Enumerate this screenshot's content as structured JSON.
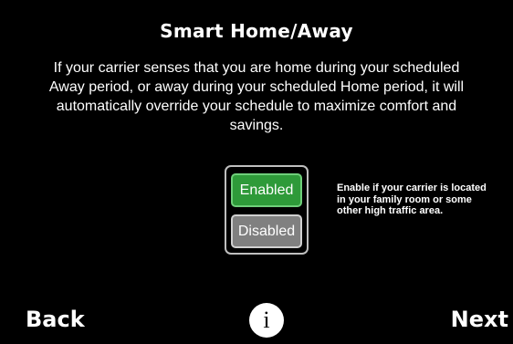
{
  "screen": {
    "title": "Smart Home/Away",
    "description": "If your carrier senses that you are home during your scheduled Away period, or away during your scheduled Home period, it will automatically override your schedule to maximize comfort and savings."
  },
  "toggle": {
    "enabled_label": "Enabled",
    "disabled_label": "Disabled",
    "selected": "Enabled"
  },
  "hint": "Enable if your carrier is located in your family room or some other high traffic area.",
  "footer": {
    "back_label": "Back",
    "info_label": "i",
    "next_label": "Next"
  },
  "colors": {
    "background": "#000000",
    "enabled_green": "#2e9a39",
    "disabled_gray": "#808080"
  },
  "icons": {
    "info": "info-icon"
  }
}
